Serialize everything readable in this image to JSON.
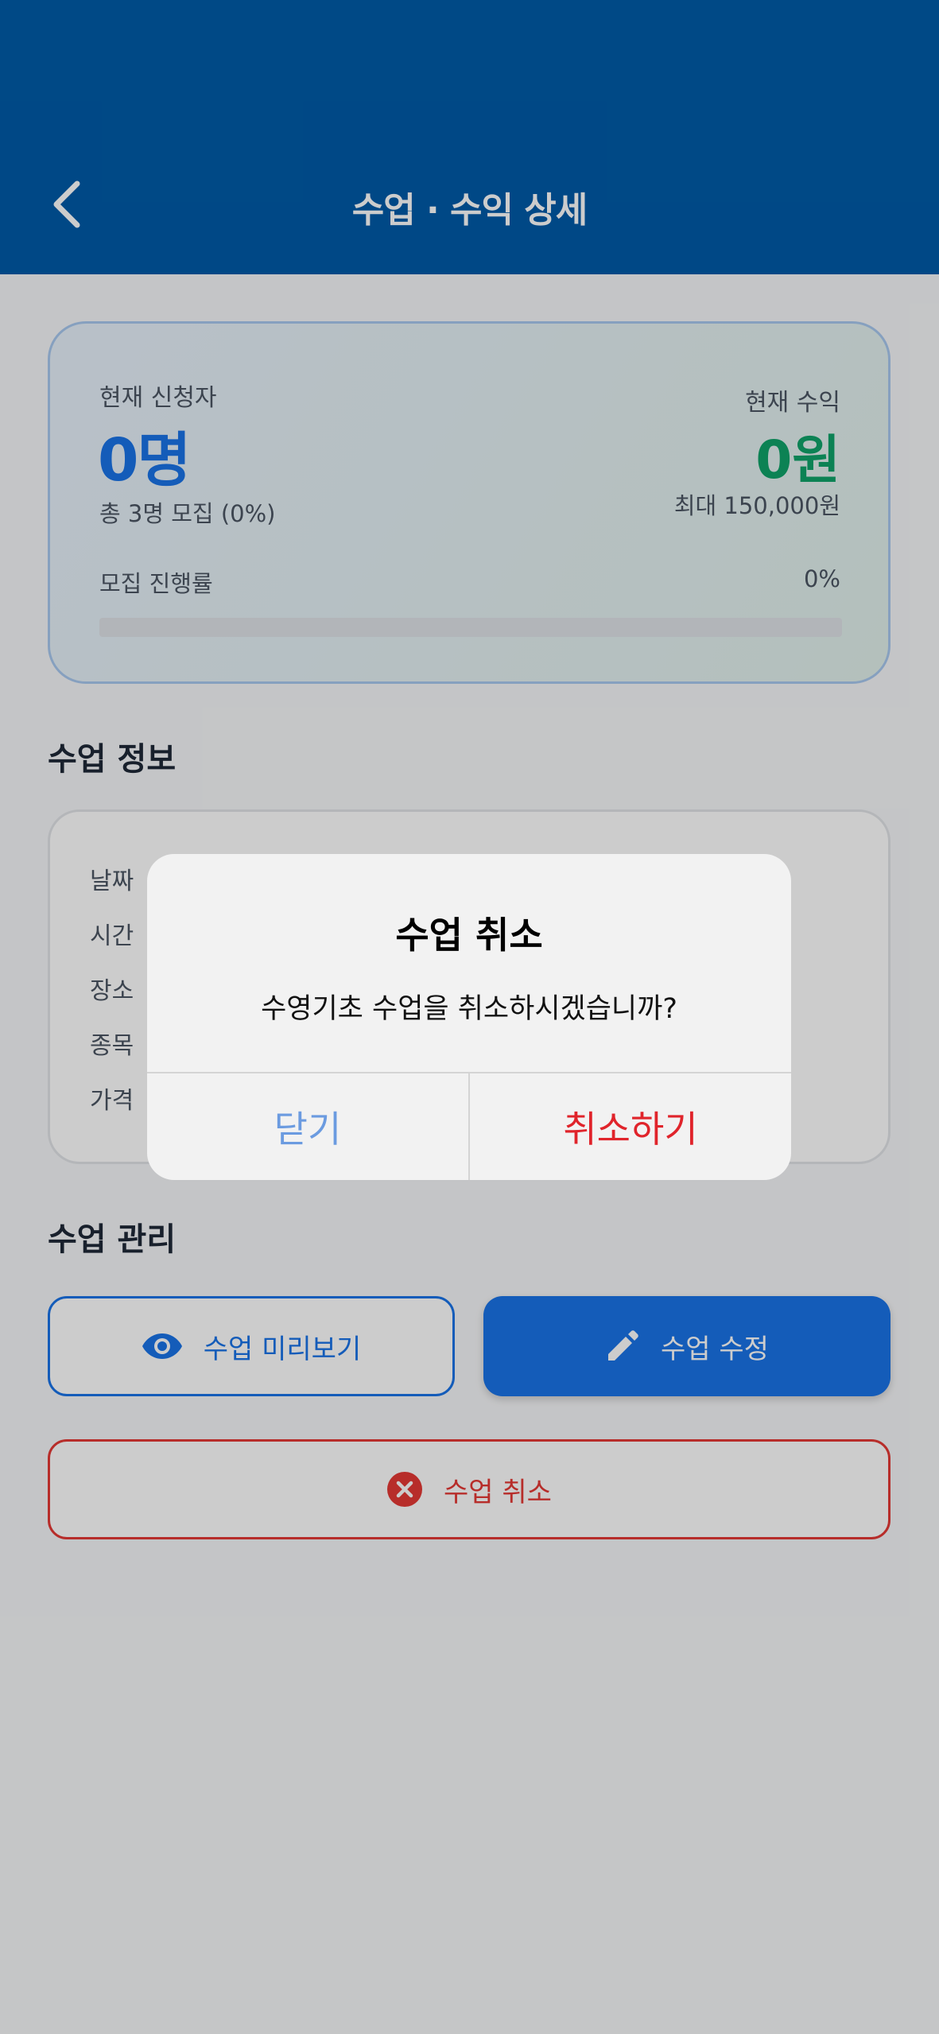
{
  "header": {
    "title": "수업 · 수익 상세"
  },
  "summary": {
    "applicants_label": "현재 신청자",
    "applicants_value": "0명",
    "applicants_sub": "총 3명 모집 (0%)",
    "revenue_label": "현재 수익",
    "revenue_value": "0원",
    "revenue_sub": "최대 150,000원",
    "progress_label": "모집 진행률",
    "progress_value": "0%",
    "progress_fraction": 0
  },
  "info": {
    "section_title": "수업 정보",
    "labels": [
      "날짜",
      "시간",
      "장소",
      "종목",
      "가격"
    ]
  },
  "management": {
    "section_title": "수업 관리",
    "preview_label": "수업 미리보기",
    "edit_label": "수업 수정",
    "cancel_label": "수업 취소"
  },
  "dialog": {
    "title": "수업 취소",
    "message": "수영기초 수업을 취소하시겠습니까?",
    "close_label": "닫기",
    "confirm_label": "취소하기"
  },
  "colors": {
    "header_bg": "#005ba8",
    "primary": "#1a73e8",
    "revenue_green": "#10a36a",
    "danger": "#e53935"
  },
  "icons": {
    "back": "chevron-left-icon",
    "preview": "eye-icon",
    "edit": "pencil-icon",
    "cancel": "close-circle-icon"
  }
}
